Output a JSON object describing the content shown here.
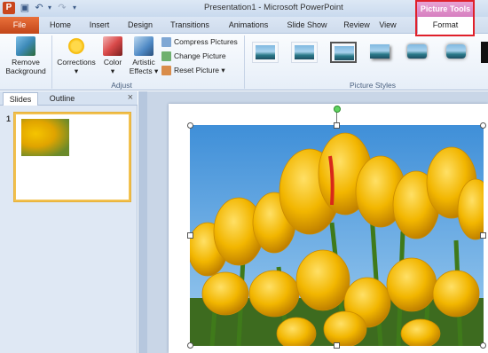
{
  "titlebar": {
    "app_icon": "P",
    "title": "Presentation1 - Microsoft PowerPoint",
    "contextual_group": "Picture Tools",
    "qat_icons": [
      "save-icon",
      "undo-icon",
      "redo-icon",
      "customize-icon"
    ]
  },
  "tabs": [
    {
      "id": "file",
      "label": "File"
    },
    {
      "id": "home",
      "label": "Home"
    },
    {
      "id": "insert",
      "label": "Insert"
    },
    {
      "id": "design",
      "label": "Design"
    },
    {
      "id": "transitions",
      "label": "Transitions"
    },
    {
      "id": "animations",
      "label": "Animations"
    },
    {
      "id": "slideshow",
      "label": "Slide Show"
    },
    {
      "id": "review",
      "label": "Review"
    },
    {
      "id": "view",
      "label": "View"
    },
    {
      "id": "format",
      "label": "Format",
      "active": true
    }
  ],
  "ribbon": {
    "remove_background": [
      "Remove",
      "Background"
    ],
    "corrections": "Corrections",
    "color": "Color",
    "artistic_effects": [
      "Artistic",
      "Effects"
    ],
    "compress_pictures": "Compress Pictures",
    "change_picture": "Change Picture",
    "reset_picture": "Reset Picture",
    "adjust_group": "Adjust",
    "picture_styles_group": "Picture Styles"
  },
  "pane": {
    "tab_slides": "Slides",
    "tab_outline": "Outline",
    "close": "×",
    "slide_number": "1"
  },
  "colors": {
    "file_tab": "#c2461a",
    "contextual_tab": "#d77fc0",
    "highlight": "#e0202a",
    "selected_thumb_border": "#f2c14e"
  }
}
